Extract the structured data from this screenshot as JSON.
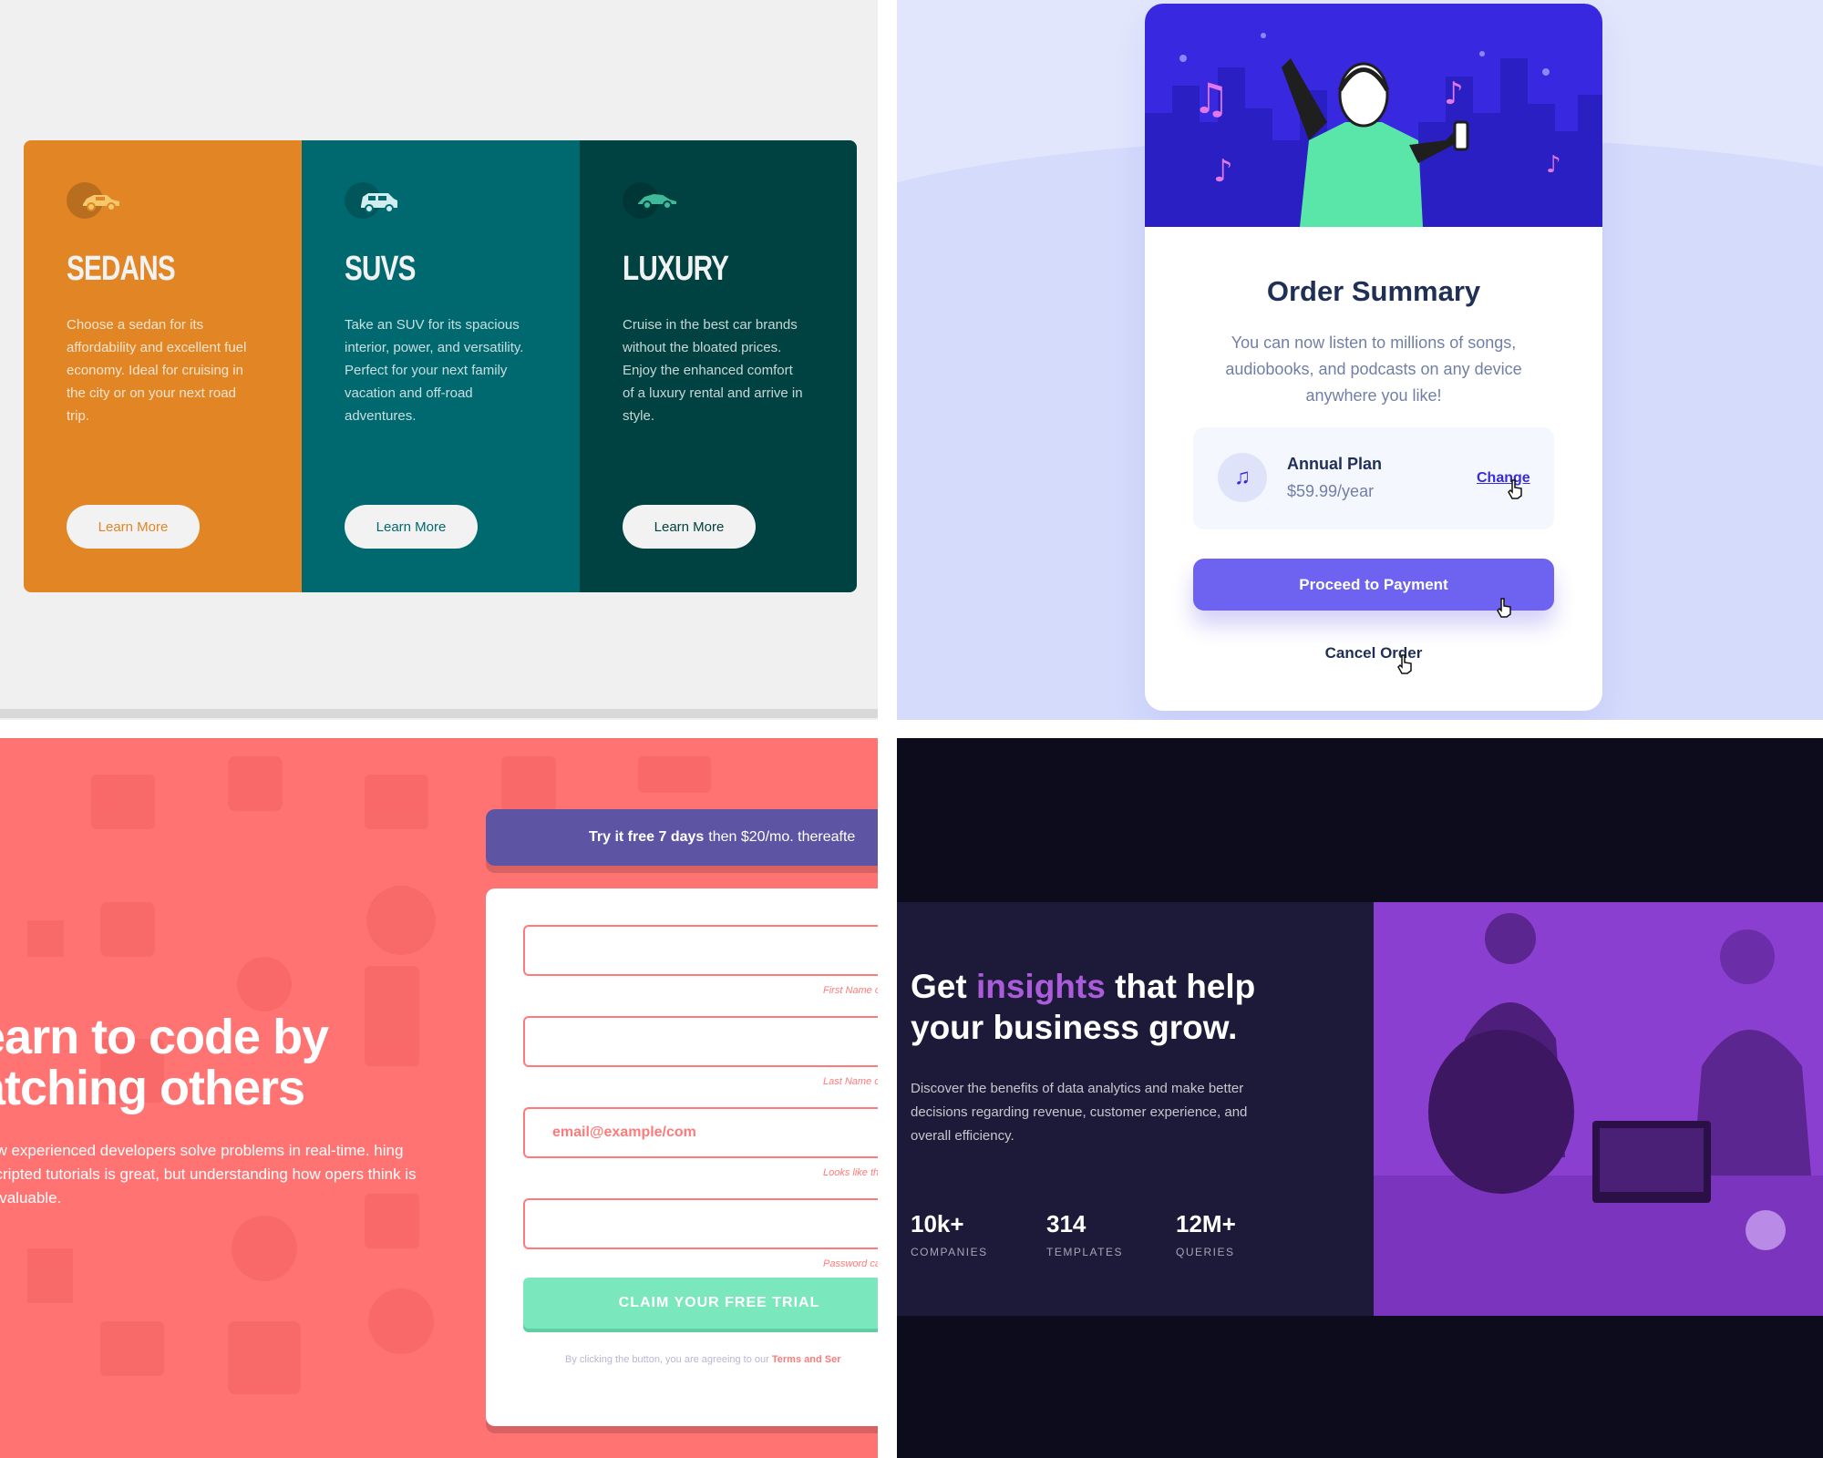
{
  "cars": {
    "cards": [
      {
        "title": "SEDANS",
        "text": "Choose a sedan for its affordability and excellent fuel economy. Ideal for cruising in the city or on your next road trip.",
        "button": "Learn More",
        "color": "#e28625"
      },
      {
        "title": "SUVS",
        "text": "Take an SUV for its spacious interior, power, and versatility. Perfect for your next family vacation and off-road adventures.",
        "button": "Learn More",
        "color": "#006970"
      },
      {
        "title": "LUXURY",
        "text": "Cruise in the best car brands without the bloated prices. Enjoy the enhanced comfort of a luxury rental and arrive in style.",
        "button": "Learn More",
        "color": "#004241"
      }
    ]
  },
  "order": {
    "title": "Order Summary",
    "description": "You can now listen to millions of songs, audiobooks, and podcasts on any device anywhere you like!",
    "plan_name": "Annual Plan",
    "plan_price": "$59.99/year",
    "change_label": "Change",
    "pay_label": "Proceed to Payment",
    "cancel_label": "Cancel Order",
    "accent": "#382ae1"
  },
  "signup": {
    "headline_1": "earn to code by",
    "headline_2": "atching others",
    "copy": "ow experienced developers solve problems in real-time. hing scripted tutorials is great, but understanding how opers think is invaluable.",
    "banner_bold": "Try it free 7 days",
    "banner_rest": "then $20/mo. thereafte",
    "email_placeholder": "email@example/com",
    "errors": [
      "First Name car",
      "Last Name car",
      "Looks like this i",
      "Password car"
    ],
    "claim_label": "CLAIM YOUR FREE TRIAL",
    "terms_text": "By clicking the button, you are agreeing to our",
    "terms_link": "Terms and Ser"
  },
  "insights": {
    "title_pre": "Get",
    "title_accent": "insights",
    "title_post": "that help",
    "title_line2": "your business grow.",
    "description": "Discover the benefits of data analytics and make better decisions regarding revenue, customer experience, and overall efficiency.",
    "stats": [
      {
        "value": "10k+",
        "label": "COMPANIES"
      },
      {
        "value": "314",
        "label": "TEMPLATES"
      },
      {
        "value": "12M+",
        "label": "QUERIES"
      }
    ],
    "accent": "#ab5cdb"
  }
}
